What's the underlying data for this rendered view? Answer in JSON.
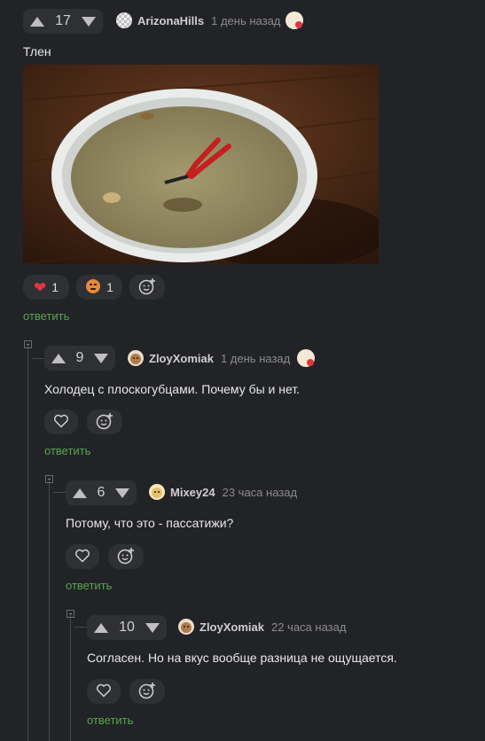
{
  "comments": [
    {
      "score": "17",
      "author": "ArizonaHills",
      "time": "1 день назад",
      "text": "Тлен",
      "reactions": [
        {
          "icon": "heart-icon",
          "count": "1"
        },
        {
          "icon": "angry-face-icon",
          "count": "1"
        }
      ],
      "reply_label": "ответить"
    },
    {
      "score": "9",
      "author": "ZloyXomiak",
      "time": "1 день назад",
      "text": "Холодец с плоскогубцами. Почему бы и нет.",
      "reply_label": "ответить"
    },
    {
      "score": "6",
      "author": "Mixey24",
      "time": "23 часа назад",
      "text": "Потому, что это - пассатижи?",
      "reply_label": "ответить"
    },
    {
      "score": "10",
      "author": "ZloyXomiak",
      "time": "22 часа назад",
      "text": "Согласен. Но на вкус вообще разница не ощущается.",
      "reply_label": "ответить"
    }
  ],
  "colors": {
    "background": "#222326",
    "reply_link": "#56a64f",
    "pill": "#2f3034",
    "heart": "#e0353f"
  }
}
